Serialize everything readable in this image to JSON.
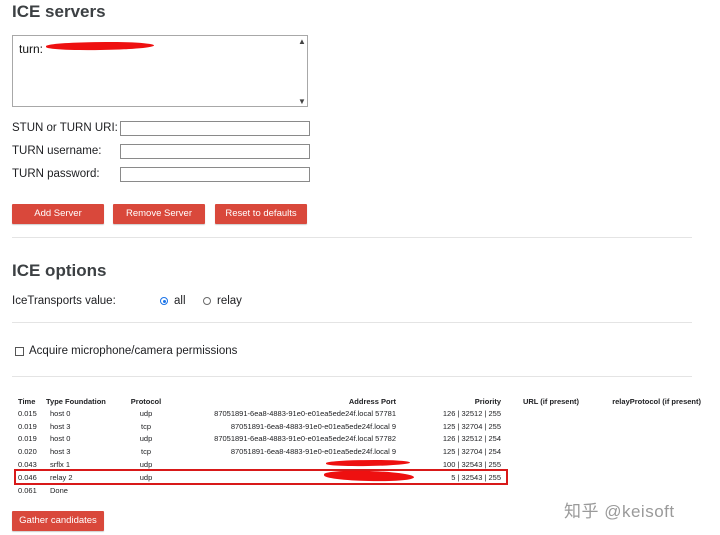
{
  "ice_servers": {
    "heading": "ICE servers",
    "list_entry_prefix": "turn:",
    "uri_label": "STUN or TURN URI:",
    "uri_value": "",
    "username_label": "TURN username:",
    "username_value": "",
    "password_label": "TURN password:",
    "password_value": "",
    "add_button": "Add Server",
    "remove_button": "Remove Server",
    "reset_button": "Reset to defaults"
  },
  "ice_options": {
    "heading": "ICE options",
    "transports_label": "IceTransports value:",
    "option_all": "all",
    "option_relay": "relay",
    "selected": "all"
  },
  "permissions": {
    "label": "Acquire microphone/camera permissions",
    "checked": false
  },
  "candidates": {
    "headers": {
      "time": "Time",
      "type": "Type",
      "foundation": "Foundation",
      "protocol": "Protocol",
      "address": "Address",
      "port": "Port",
      "priority": "Priority",
      "url": "URL (if present)",
      "relay_protocol": "relayProtocol (if present)"
    },
    "rows": [
      {
        "time": "0.015",
        "type": "host",
        "foundation": "0",
        "protocol": "udp",
        "address": "87051891-6ea8-4883-91e0-e01ea5ede24f.local",
        "port": "57781",
        "priority": "126 | 32512 | 255"
      },
      {
        "time": "0.019",
        "type": "host",
        "foundation": "3",
        "protocol": "tcp",
        "address": "87051891-6ea8-4883-91e0-e01ea5ede24f.local",
        "port": "9",
        "priority": "125 | 32704 | 255"
      },
      {
        "time": "0.019",
        "type": "host",
        "foundation": "0",
        "protocol": "udp",
        "address": "87051891-6ea8-4883-91e0-e01ea5ede24f.local",
        "port": "57782",
        "priority": "126 | 32512 | 254"
      },
      {
        "time": "0.020",
        "type": "host",
        "foundation": "3",
        "protocol": "tcp",
        "address": "87051891-6ea8-4883-91e0-e01ea5ede24f.local",
        "port": "9",
        "priority": "125 | 32704 | 254"
      },
      {
        "time": "0.043",
        "type": "srflx",
        "foundation": "1",
        "protocol": "udp",
        "address": "",
        "port": "",
        "priority": "100 | 32543 | 255"
      },
      {
        "time": "0.046",
        "type": "relay",
        "foundation": "2",
        "protocol": "udp",
        "address": "",
        "port": "",
        "priority": "5 | 32543 | 255"
      }
    ],
    "done_time": "0.061",
    "done_label": "Done"
  },
  "gather_button": "Gather candidates",
  "watermark": "知乎 @keisoft",
  "colors": {
    "button_red": "#d9483b",
    "highlight_red": "#d81919",
    "radio_blue": "#1a73e8"
  }
}
